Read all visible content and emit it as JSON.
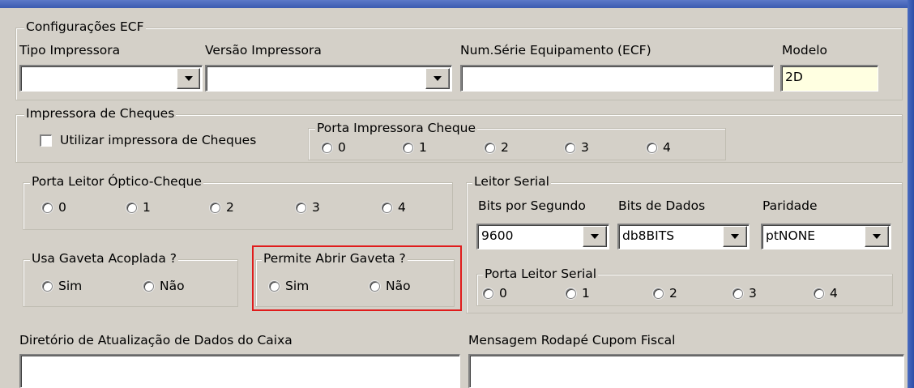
{
  "ecf": {
    "legend": "Configurações ECF",
    "tipo_label": "Tipo Impressora",
    "tipo_value": "",
    "versao_label": "Versão Impressora",
    "versao_value": "",
    "numserie_label": "Num.Série Equipamento (ECF)",
    "numserie_value": "",
    "modelo_label": "Modelo",
    "modelo_value": "2D"
  },
  "cheques": {
    "legend": "Impressora de Cheques",
    "checkbox_label": "Utilizar impressora de Cheques",
    "checked": false,
    "porta_legend": "Porta Impressora Cheque",
    "porta_options": [
      "0",
      "1",
      "2",
      "3",
      "4"
    ]
  },
  "leitor_optico": {
    "legend": "Porta Leitor Óptico-Cheque",
    "options": [
      "0",
      "1",
      "2",
      "3",
      "4"
    ]
  },
  "gaveta_acoplada": {
    "legend": "Usa Gaveta Acoplada ?",
    "options": [
      "Sim",
      "Não"
    ]
  },
  "abrir_gaveta": {
    "legend": "Permite Abrir Gaveta ?",
    "options": [
      "Sim",
      "Não"
    ],
    "highlight_color": "#e01b1b"
  },
  "leitor_serial": {
    "legend": "Leitor Serial",
    "bits_segundo_label": "Bits por Segundo",
    "bits_segundo_value": "9600",
    "bits_dados_label": "Bits de Dados",
    "bits_dados_value": "db8BITS",
    "paridade_label": "Paridade",
    "paridade_value": "ptNONE",
    "porta_legend": "Porta Leitor Serial",
    "porta_options": [
      "0",
      "1",
      "2",
      "3",
      "4"
    ]
  },
  "diretorio": {
    "label": "Diretório de Atualização de Dados do Caixa",
    "value": ""
  },
  "mensagem": {
    "label": "Mensagem Rodapé Cupom Fiscal",
    "value": ""
  },
  "colors": {
    "window_bg": "#d4d0c8",
    "title_bar": "#3b5bb0",
    "field_bg": "#ffffff",
    "modelo_bg": "#ffffe1"
  }
}
